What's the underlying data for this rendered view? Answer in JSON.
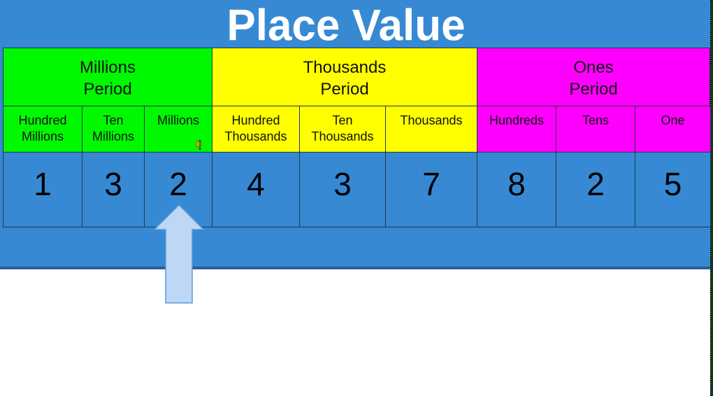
{
  "title": "Place Value",
  "periods": [
    {
      "label_line1": "Millions",
      "label_line2": "Period",
      "color": "#00f800"
    },
    {
      "label_line1": "Thousands",
      "label_line2": "Period",
      "color": "#ffff00"
    },
    {
      "label_line1": "Ones",
      "label_line2": "Period",
      "color": "#ff00ff"
    }
  ],
  "places": [
    {
      "line1": "Hundred",
      "line2": "Millions",
      "digit": "1",
      "period": 0
    },
    {
      "line1": "Ten",
      "line2": "Millions",
      "digit": "3",
      "period": 0
    },
    {
      "line1": "Millions",
      "line2": "",
      "digit": "2",
      "period": 0
    },
    {
      "line1": "Hundred",
      "line2": "Thousands",
      "digit": "4",
      "period": 1
    },
    {
      "line1": "Ten",
      "line2": "Thousands",
      "digit": "3",
      "period": 1
    },
    {
      "line1": "Thousands",
      "line2": "",
      "digit": "7",
      "period": 1
    },
    {
      "line1": "Hundreds",
      "line2": "",
      "digit": "8",
      "period": 2
    },
    {
      "line1": "Tens",
      "line2": "",
      "digit": "2",
      "period": 2
    },
    {
      "line1": "One",
      "line2": "",
      "digit": "5",
      "period": 2
    }
  ],
  "highlighted_place_index": 2,
  "colors": {
    "background_blue": "#3789d4",
    "arrow_fill": "#bdd7f5",
    "arrow_stroke": "#5b9bd5"
  }
}
